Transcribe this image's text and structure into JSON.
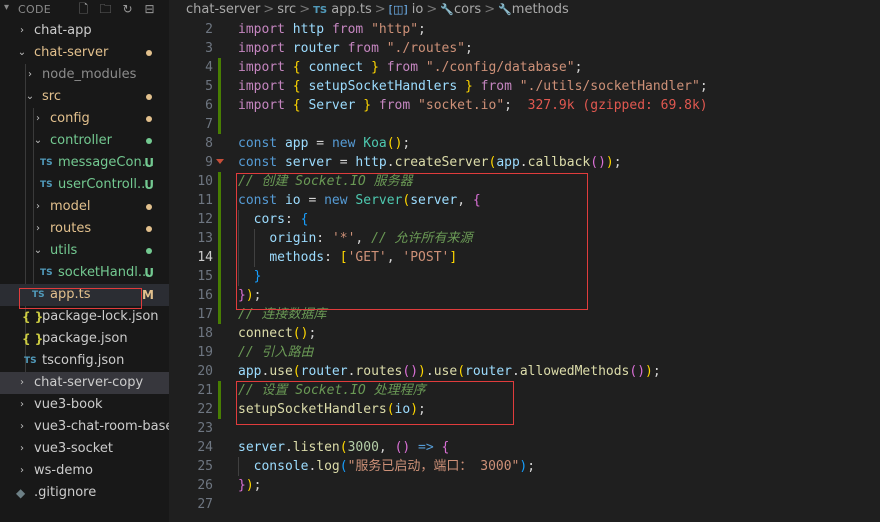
{
  "explorer": {
    "title": "CODE",
    "items": [
      {
        "label": "chat-app"
      },
      {
        "label": "chat-server"
      },
      {
        "label": "node_modules"
      },
      {
        "label": "src"
      },
      {
        "label": "config"
      },
      {
        "label": "controller"
      },
      {
        "label": "messageCon...",
        "status": "U"
      },
      {
        "label": "userControll...",
        "status": "U"
      },
      {
        "label": "model"
      },
      {
        "label": "routes"
      },
      {
        "label": "utils"
      },
      {
        "label": "socketHandl...",
        "status": "U"
      },
      {
        "label": "app.ts",
        "status": "M"
      },
      {
        "label": "package-lock.json"
      },
      {
        "label": "package.json"
      },
      {
        "label": "tsconfig.json"
      },
      {
        "label": "chat-server-copy"
      },
      {
        "label": "vue3-book"
      },
      {
        "label": "vue3-chat-room-base"
      },
      {
        "label": "vue3-socket"
      },
      {
        "label": "ws-demo"
      },
      {
        "label": ".gitignore"
      }
    ],
    "icons": {
      "ts": "TS",
      "json": "{ }",
      "git": "◆"
    }
  },
  "breadcrumb": {
    "items": [
      "chat-server",
      "src",
      "app.ts",
      "io",
      "cors",
      "methods"
    ],
    "separator": ">"
  },
  "editor": {
    "line_numbers": [
      "2",
      "3",
      "4",
      "5",
      "6",
      "7",
      "8",
      "9",
      "10",
      "11",
      "12",
      "13",
      "14",
      "15",
      "16",
      "17",
      "18",
      "19",
      "20",
      "21",
      "22",
      "23",
      "24",
      "25",
      "26",
      "27"
    ],
    "current_line": "14",
    "inline_hint": "327.9k (gzipped: 69.8k)",
    "lines": {
      "l2": [
        "import",
        " ",
        "http",
        " ",
        "from",
        " ",
        "\"http\"",
        ";"
      ],
      "l3": [
        "import",
        " ",
        "router",
        " ",
        "from",
        " ",
        "\"./routes\"",
        ";"
      ],
      "l4": [
        "import",
        " ",
        "{",
        " ",
        "connect",
        " ",
        "}",
        " ",
        "from",
        " ",
        "\"./config/database\"",
        ";"
      ],
      "l5": [
        "import",
        " ",
        "{",
        " ",
        "setupSocketHandlers",
        " ",
        "}",
        " ",
        "from",
        " ",
        "\"./utils/socketHandler\"",
        ";"
      ],
      "l6": [
        "import",
        " ",
        "{",
        " ",
        "Server",
        " ",
        "}",
        " ",
        "from",
        " ",
        "\"socket.io\"",
        ";"
      ],
      "l8": [
        "const",
        " ",
        "app",
        " = ",
        "new",
        " ",
        "Koa",
        "(",
        ")",
        ";"
      ],
      "l9": [
        "const",
        " ",
        "server",
        " = ",
        "http",
        ".",
        "createServer",
        "(",
        "app",
        ".",
        "callback",
        "(",
        ")",
        ")",
        ";"
      ],
      "l10": [
        "// 创建 Socket.IO 服务器"
      ],
      "l11": [
        "const",
        " ",
        "io",
        " = ",
        "new",
        " ",
        "Server",
        "(",
        "server",
        ", ",
        "{"
      ],
      "l12": [
        "cors",
        ": ",
        "{"
      ],
      "l13": [
        "origin",
        ": ",
        "'*'",
        ", ",
        "// 允许所有来源"
      ],
      "l14": [
        "methods",
        ": ",
        "[",
        "'GET'",
        ", ",
        "'POST'",
        "]"
      ],
      "l15": [
        "}"
      ],
      "l16": [
        "}",
        ")",
        ";"
      ],
      "l17": [
        "// 连接数据库"
      ],
      "l18": [
        "connect",
        "(",
        ")",
        ";"
      ],
      "l19": [
        "// 引入路由"
      ],
      "l20": [
        "app",
        ".",
        "use",
        "(",
        "router",
        ".",
        "routes",
        "(",
        ")",
        ")",
        ".",
        "use",
        "(",
        "router",
        ".",
        "allowedMethods",
        "(",
        ")",
        ")",
        ";"
      ],
      "l21": [
        "// 设置 Socket.IO 处理程序"
      ],
      "l22": [
        "setupSocketHandlers",
        "(",
        "io",
        ")",
        ";"
      ],
      "l24": [
        "server",
        ".",
        "listen",
        "(",
        "3000",
        ", ",
        "(",
        ")",
        " => ",
        "{"
      ],
      "l25": [
        "console",
        ".",
        "log",
        "(",
        "\"服务已启动，端口： 3000\"",
        ")",
        ";"
      ],
      "l26": [
        "}",
        ")",
        ";"
      ]
    }
  },
  "colors": {
    "accent_red_box": "#e03c3c",
    "git_untracked": "#73c991",
    "git_modified": "#e2c08d"
  }
}
